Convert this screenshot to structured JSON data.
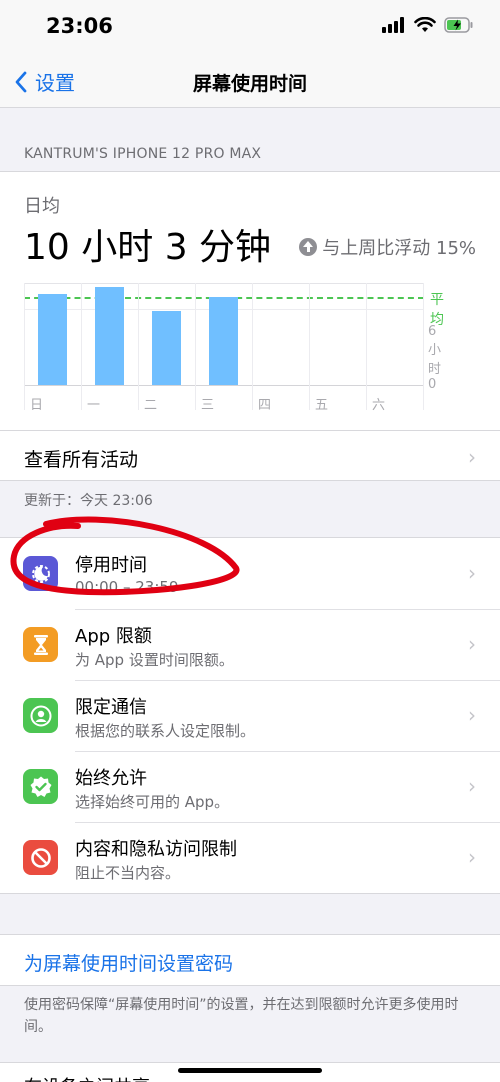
{
  "status_bar": {
    "time": "23:06",
    "icons": [
      "signal-icon",
      "wifi-icon",
      "battery-charging-icon"
    ]
  },
  "nav": {
    "back_label": "设置",
    "title": "屏幕使用时间"
  },
  "device_header": "KANTRUM'S IPHONE 12 PRO MAX",
  "summary": {
    "avg_label": "日均",
    "total_time": "10 小时 3 分钟",
    "trend_text": "与上周比浮动 15%",
    "trend_direction": "up"
  },
  "chart_data": {
    "type": "bar",
    "categories": [
      "日",
      "一",
      "二",
      "三",
      "四",
      "五",
      "六"
    ],
    "values": [
      10.4,
      11.1,
      8.4,
      10.0,
      0,
      0,
      0
    ],
    "ylabel": "",
    "tick_labels": [
      "6 小时",
      "0"
    ],
    "average_label": "平均",
    "average_value": 10.05,
    "ylim": [
      0,
      11.6
    ],
    "grid": true,
    "colors": {
      "bar": "#70bfff",
      "average": "#4cc552"
    }
  },
  "see_all": "查看所有活动",
  "updated": "更新于：今天 23:06",
  "items": [
    {
      "title": "停用时间",
      "subtitle": "00:00 – 23:59",
      "icon": "downtime-icon",
      "color": "#5b58d6"
    },
    {
      "title": "App 限额",
      "subtitle": "为 App 设置时间限额。",
      "icon": "hourglass-icon",
      "color": "#f39c24"
    },
    {
      "title": "限定通信",
      "subtitle": "根据您的联系人设定限制。",
      "icon": "contact-icon",
      "color": "#4cc552"
    },
    {
      "title": "始终允许",
      "subtitle": "选择始终可用的 App。",
      "icon": "checkmark-badge-icon",
      "color": "#4cc552"
    },
    {
      "title": "内容和隐私访问限制",
      "subtitle": "阻止不当内容。",
      "icon": "block-icon",
      "color": "#ea4c3f"
    }
  ],
  "passcode_link": "为屏幕使用时间设置密码",
  "footer_text": "使用密码保障“屏幕使用时间”的设置，并在达到限额时允许更多使用时间。",
  "bottom_partial": "在设备之间共享",
  "annotation_color": "#e00012"
}
